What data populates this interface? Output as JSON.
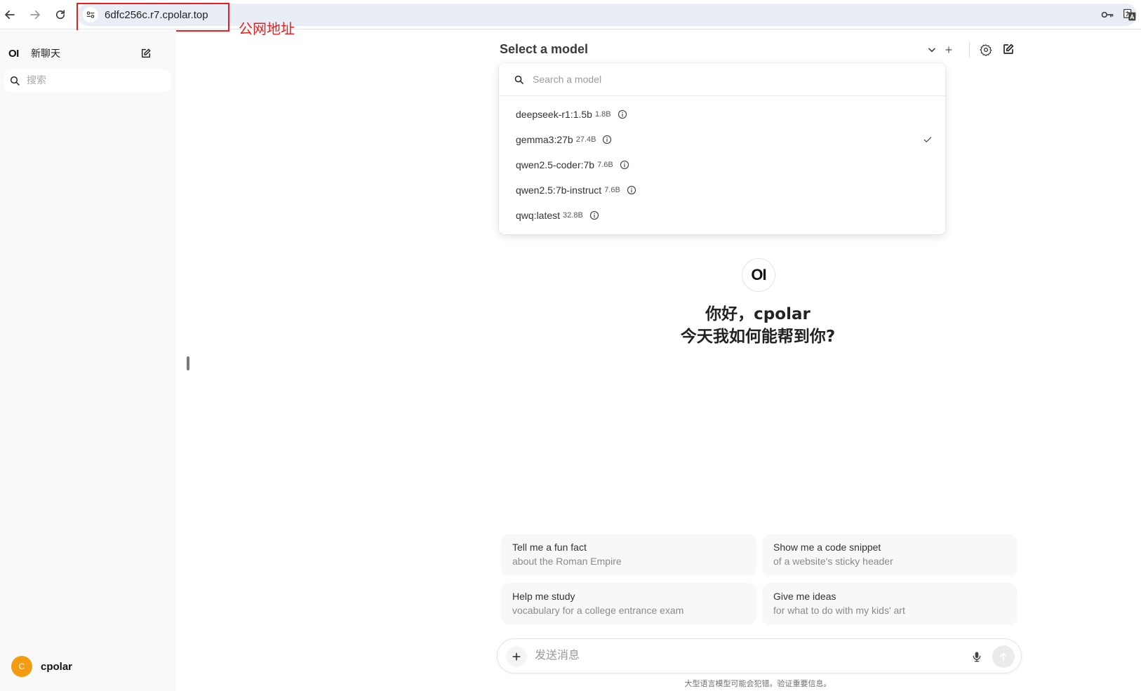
{
  "browser": {
    "url": "6dfc256c.r7.cpolar.top",
    "annotation_label": "公网地址",
    "annotation_color": "#ee1d1d"
  },
  "sidebar": {
    "logo": "OI",
    "new_chat_label": "新聊天",
    "search_placeholder": "搜索",
    "user_initial": "C",
    "user_name": "cpolar",
    "avatar_color": "#f39c12"
  },
  "header": {
    "model_selector_label": "Select a model",
    "icons": [
      "chevron-down-icon",
      "plus-icon",
      "settings-icon",
      "edit-icon"
    ]
  },
  "model_dropdown": {
    "search_placeholder": "Search a model",
    "selected_index": 1,
    "models": [
      {
        "name": "deepseek-r1:1.5b",
        "size": "1.8B",
        "selected": false
      },
      {
        "name": "gemma3:27b",
        "size": "27.4B",
        "selected": true
      },
      {
        "name": "qwen2.5-coder:7b",
        "size": "7.6B",
        "selected": false
      },
      {
        "name": "qwen2.5:7b-instruct",
        "size": "7.6B",
        "selected": false
      },
      {
        "name": "qwq:latest",
        "size": "32.8B",
        "selected": false
      }
    ]
  },
  "greeting": {
    "logo": "OI",
    "line1": "你好，cpolar",
    "line2": "今天我如何能帮到你?"
  },
  "suggestions": [
    {
      "title": "Tell me a fun fact",
      "subtitle": "about the Roman Empire"
    },
    {
      "title": "Show me a code snippet",
      "subtitle": "of a website's sticky header"
    },
    {
      "title": "Help me study",
      "subtitle": "vocabulary for a college entrance exam"
    },
    {
      "title": "Give me ideas",
      "subtitle": "for what to do with my kids' art"
    }
  ],
  "composer": {
    "placeholder": "发送消息",
    "disclaimer": "大型语言模型可能会犯错。验证重要信息。"
  }
}
